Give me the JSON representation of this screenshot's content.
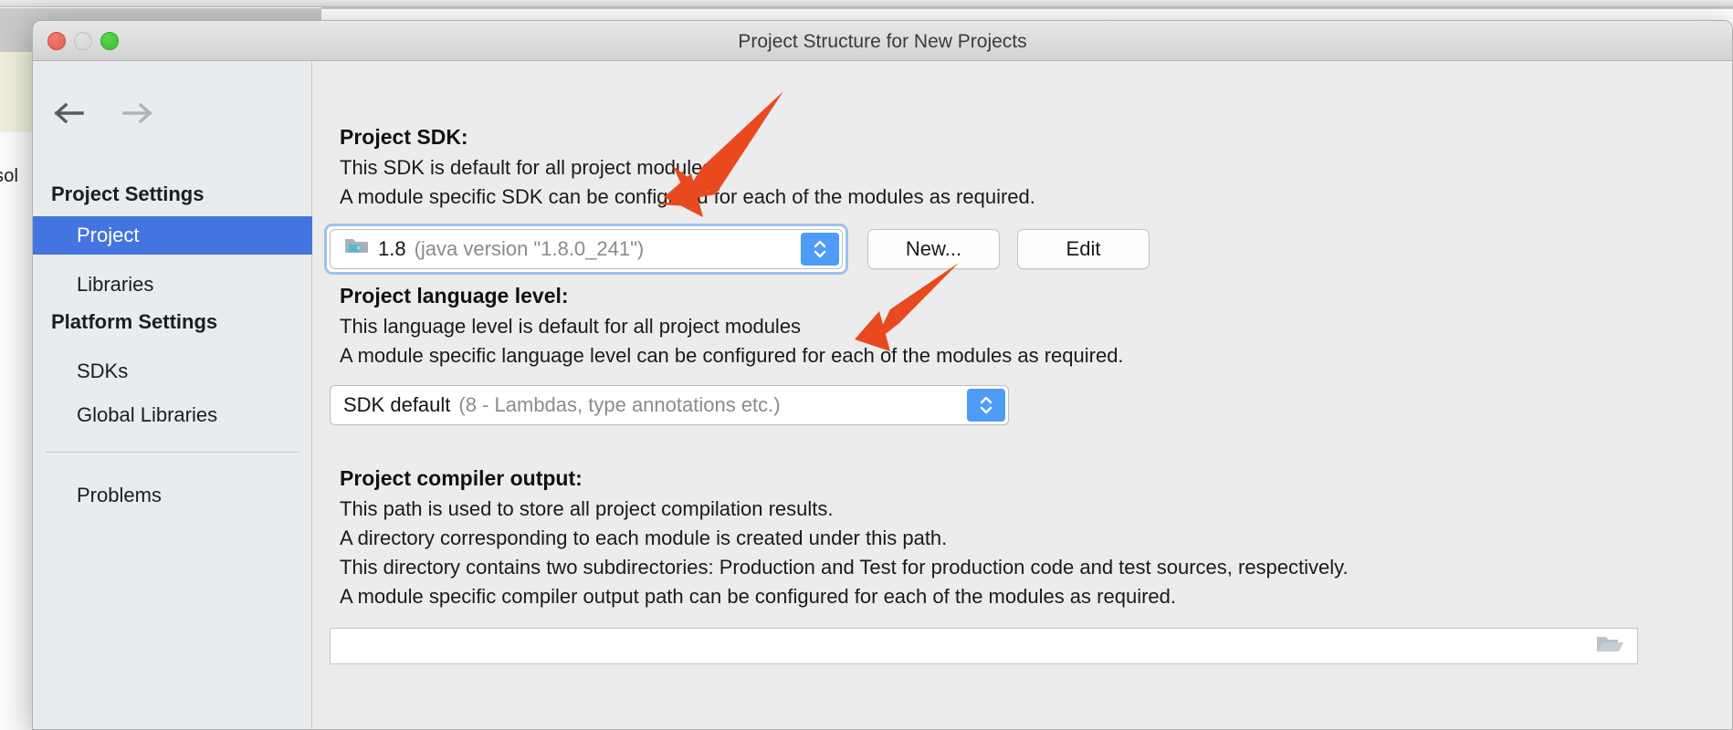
{
  "backdrop": {
    "left_text": "sol"
  },
  "window": {
    "title": "Project Structure for New Projects",
    "traffic_lights": [
      "close",
      "minimize",
      "zoom"
    ]
  },
  "sidebar": {
    "nav": {
      "back_icon": "arrow-left-icon",
      "forward_icon": "arrow-right-icon"
    },
    "groups": [
      {
        "heading": "Project Settings",
        "items": [
          {
            "label": "Project",
            "selected": true
          },
          {
            "label": "Libraries",
            "selected": false
          }
        ]
      },
      {
        "heading": "Platform Settings",
        "items": [
          {
            "label": "SDKs",
            "selected": false
          },
          {
            "label": "Global Libraries",
            "selected": false
          }
        ]
      }
    ],
    "footer_items": [
      {
        "label": "Problems",
        "selected": false
      }
    ]
  },
  "main": {
    "sdk_section": {
      "heading": "Project SDK:",
      "lines": [
        "This SDK is default for all project modules.",
        "A module specific SDK can be configured for each of the modules as required."
      ],
      "combo": {
        "icon": "java-sdk-folder-icon",
        "value": "1.8",
        "detail": "(java version \"1.8.0_241\")",
        "stepper_icon": "stepper-up-down-icon",
        "focused": true
      },
      "buttons": [
        {
          "label": "New..."
        },
        {
          "label": "Edit"
        }
      ]
    },
    "language_section": {
      "heading": "Project language level:",
      "lines": [
        "This language level is default for all project modules",
        "A module specific language level can be configured for each of the modules as required."
      ],
      "combo": {
        "value": "SDK default",
        "detail": "(8 - Lambdas, type annotations etc.)",
        "stepper_icon": "stepper-up-down-icon",
        "focused": false
      }
    },
    "compiler_section": {
      "heading": "Project compiler output:",
      "lines": [
        "This path is used to store all project compilation results.",
        "A directory corresponding to each module is created under this path.",
        "This directory contains two subdirectories: Production and Test for production code and test sources, respectively.",
        "A module specific compiler output path can be configured for each of the modules as required."
      ],
      "path_field": {
        "value": "",
        "placeholder": "",
        "browse_icon": "open-folder-icon"
      }
    }
  },
  "annotations": {
    "color": "#E8491F",
    "arrows": [
      {
        "name": "arrow-to-sdk-combo",
        "target": "project-sdk-combo"
      },
      {
        "name": "arrow-to-language-level-combo",
        "target": "language-level-combo"
      }
    ]
  },
  "colors": {
    "selection_blue": "#4374e0",
    "stepper_blue": "#4e9cf5",
    "focus_ring": "#9cc2f0",
    "annotation_orange": "#E8491F",
    "sidebar_bg": "#e8ecef",
    "dialog_bg": "#ececec"
  }
}
